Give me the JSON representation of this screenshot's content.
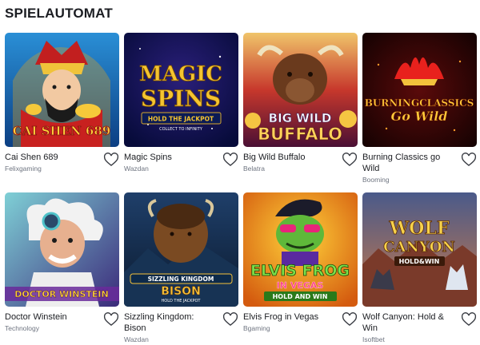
{
  "section": {
    "title": "SPIELAUTOMAT"
  },
  "games": [
    {
      "title": "Cai Shen 689",
      "provider": "Felixgaming",
      "art_text": "CAI SHEN 689",
      "icon": "heart-outline-icon"
    },
    {
      "title": "Magic Spins",
      "provider": "Wazdan",
      "art_text": "MAGIC SPINS",
      "art_subtext": "HOLD THE JACKPOT",
      "art_tagline": "COLLECT TO INFINITY",
      "icon": "heart-outline-icon"
    },
    {
      "title": "Big Wild Buffalo",
      "provider": "Belatra",
      "art_text": "BIG WILD BUFFALO",
      "icon": "heart-outline-icon"
    },
    {
      "title": "Burning Classics go Wild",
      "provider": "Booming",
      "art_text": "BURNING CLASSICS",
      "art_subtext": "Go Wild",
      "icon": "heart-outline-icon"
    },
    {
      "title": "Doctor Winstein",
      "provider": "Technology",
      "art_text": "DOCTOR WINSTEIN",
      "icon": "heart-outline-icon"
    },
    {
      "title": "Sizzling Kingdom: Bison",
      "provider": "Wazdan",
      "art_text": "SIZZLING KINGDOM",
      "art_subtext": "BISON",
      "art_tagline": "HOLD THE JACKPOT",
      "icon": "heart-outline-icon"
    },
    {
      "title": "Elvis Frog in Vegas",
      "provider": "Bgaming",
      "art_text": "ELVIS FROG",
      "art_subtext": "IN VEGAS",
      "art_tagline": "HOLD AND WIN",
      "icon": "heart-outline-icon"
    },
    {
      "title": "Wolf Canyon: Hold & Win",
      "provider": "Isoftbet",
      "art_text": "WOLF CANYON",
      "art_subtext": "HOLD&WIN",
      "icon": "heart-outline-icon"
    }
  ],
  "colors": {
    "text": "#1b1d22",
    "muted": "#6e7480",
    "heart": "#3a3d44"
  }
}
